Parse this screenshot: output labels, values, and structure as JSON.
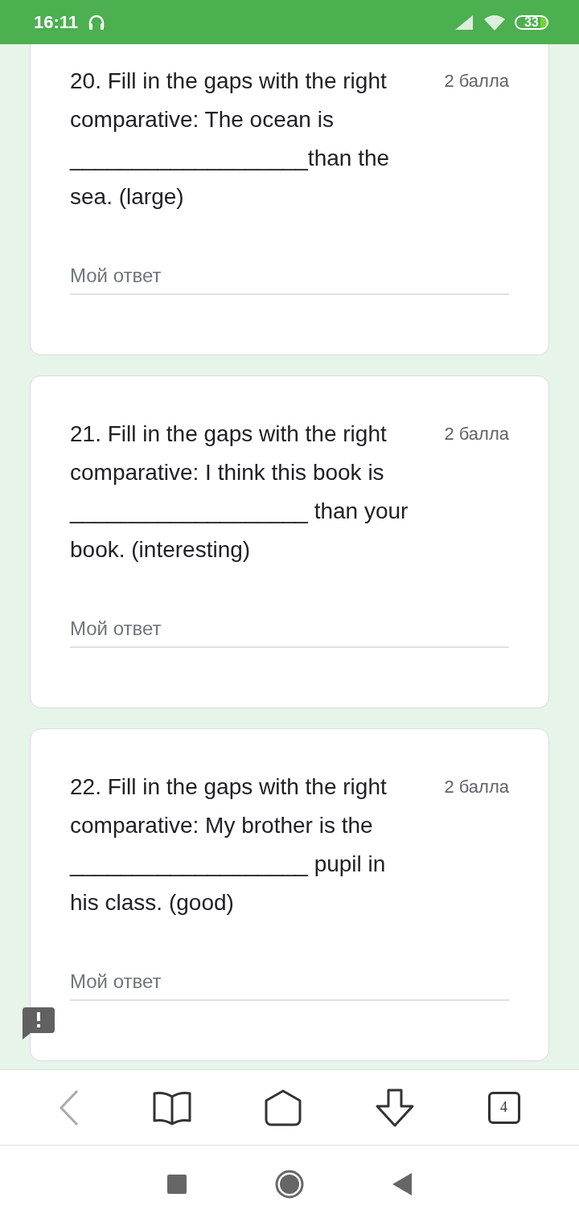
{
  "status_bar": {
    "time": "16:11",
    "battery": "33"
  },
  "questions": [
    {
      "text": "20. Fill in the gaps with the right comparative: The ocean is ___________________than the sea. (large)",
      "points": "2 балла",
      "answer_placeholder": "Мой ответ"
    },
    {
      "text": "21. Fill in the gaps with the right comparative: I think this book is ___________________ than your book. (interesting)",
      "points": "2 балла",
      "answer_placeholder": "Мой ответ"
    },
    {
      "text": "22. Fill in the gaps with the right comparative: My brother is the ___________________ pupil in his class. (good)",
      "points": "2 балла",
      "answer_placeholder": "Мой ответ"
    }
  ],
  "browser_toolbar": {
    "tab_count": "4"
  }
}
